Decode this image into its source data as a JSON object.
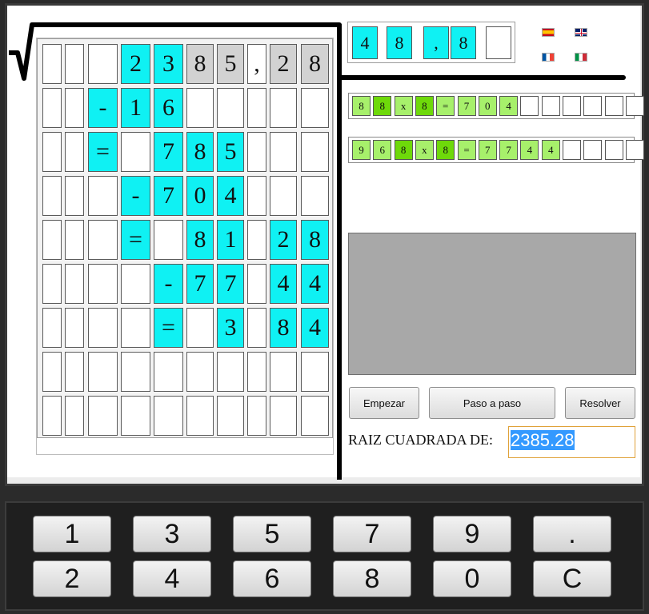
{
  "grid": {
    "rows": [
      [
        {
          "t": "",
          "c": "w"
        },
        {
          "t": "",
          "c": "w"
        },
        {
          "t": "",
          "c": "w"
        },
        {
          "t": "2",
          "c": "cyan"
        },
        {
          "t": "3",
          "c": "cyan"
        },
        {
          "t": "8",
          "c": "gray"
        },
        {
          "t": "5",
          "c": "gray"
        },
        {
          "t": ",",
          "c": "w"
        },
        {
          "t": "2",
          "c": "gray"
        },
        {
          "t": "8",
          "c": "gray"
        }
      ],
      [
        {
          "t": "",
          "c": "w"
        },
        {
          "t": "",
          "c": "w"
        },
        {
          "t": "-",
          "c": "cyan"
        },
        {
          "t": "1",
          "c": "cyan"
        },
        {
          "t": "6",
          "c": "cyan"
        },
        {
          "t": "",
          "c": "w"
        },
        {
          "t": "",
          "c": "w"
        },
        {
          "t": "",
          "c": "w"
        },
        {
          "t": "",
          "c": "w"
        },
        {
          "t": "",
          "c": "w"
        }
      ],
      [
        {
          "t": "",
          "c": "w"
        },
        {
          "t": "",
          "c": "w"
        },
        {
          "t": "=",
          "c": "cyan"
        },
        {
          "t": "",
          "c": "w"
        },
        {
          "t": "7",
          "c": "cyan"
        },
        {
          "t": "8",
          "c": "cyan"
        },
        {
          "t": "5",
          "c": "cyan"
        },
        {
          "t": "",
          "c": "w"
        },
        {
          "t": "",
          "c": "w"
        },
        {
          "t": "",
          "c": "w"
        }
      ],
      [
        {
          "t": "",
          "c": "w"
        },
        {
          "t": "",
          "c": "w"
        },
        {
          "t": "",
          "c": "w"
        },
        {
          "t": "-",
          "c": "cyan"
        },
        {
          "t": "7",
          "c": "cyan"
        },
        {
          "t": "0",
          "c": "cyan"
        },
        {
          "t": "4",
          "c": "cyan"
        },
        {
          "t": "",
          "c": "w"
        },
        {
          "t": "",
          "c": "w"
        },
        {
          "t": "",
          "c": "w"
        }
      ],
      [
        {
          "t": "",
          "c": "w"
        },
        {
          "t": "",
          "c": "w"
        },
        {
          "t": "",
          "c": "w"
        },
        {
          "t": "=",
          "c": "cyan"
        },
        {
          "t": "",
          "c": "w"
        },
        {
          "t": "8",
          "c": "cyan"
        },
        {
          "t": "1",
          "c": "cyan"
        },
        {
          "t": "",
          "c": "w"
        },
        {
          "t": "2",
          "c": "cyan"
        },
        {
          "t": "8",
          "c": "cyan"
        }
      ],
      [
        {
          "t": "",
          "c": "w"
        },
        {
          "t": "",
          "c": "w"
        },
        {
          "t": "",
          "c": "w"
        },
        {
          "t": "",
          "c": "w"
        },
        {
          "t": "-",
          "c": "cyan"
        },
        {
          "t": "7",
          "c": "cyan"
        },
        {
          "t": "7",
          "c": "cyan"
        },
        {
          "t": "",
          "c": "w"
        },
        {
          "t": "4",
          "c": "cyan"
        },
        {
          "t": "4",
          "c": "cyan"
        }
      ],
      [
        {
          "t": "",
          "c": "w"
        },
        {
          "t": "",
          "c": "w"
        },
        {
          "t": "",
          "c": "w"
        },
        {
          "t": "",
          "c": "w"
        },
        {
          "t": "=",
          "c": "cyan"
        },
        {
          "t": "",
          "c": "w"
        },
        {
          "t": "3",
          "c": "cyan"
        },
        {
          "t": "",
          "c": "w"
        },
        {
          "t": "8",
          "c": "cyan"
        },
        {
          "t": "4",
          "c": "cyan"
        }
      ],
      [
        {
          "t": "",
          "c": "w"
        },
        {
          "t": "",
          "c": "w"
        },
        {
          "t": "",
          "c": "w"
        },
        {
          "t": "",
          "c": "w"
        },
        {
          "t": "",
          "c": "w"
        },
        {
          "t": "",
          "c": "w"
        },
        {
          "t": "",
          "c": "w"
        },
        {
          "t": "",
          "c": "w"
        },
        {
          "t": "",
          "c": "w"
        },
        {
          "t": "",
          "c": "w"
        }
      ],
      [
        {
          "t": "",
          "c": "w"
        },
        {
          "t": "",
          "c": "w"
        },
        {
          "t": "",
          "c": "w"
        },
        {
          "t": "",
          "c": "w"
        },
        {
          "t": "",
          "c": "w"
        },
        {
          "t": "",
          "c": "w"
        },
        {
          "t": "",
          "c": "w"
        },
        {
          "t": "",
          "c": "w"
        },
        {
          "t": "",
          "c": "w"
        },
        {
          "t": "",
          "c": "w"
        }
      ]
    ]
  },
  "result": [
    {
      "t": "4",
      "c": "cyan"
    },
    {
      "t": "8",
      "c": "cyan"
    },
    {
      "t": ",",
      "c": "cyan"
    },
    {
      "t": "8",
      "c": "cyan"
    },
    {
      "t": "",
      "c": "w"
    }
  ],
  "languages": [
    {
      "name": "spain-flag-icon",
      "flag": "es"
    },
    {
      "name": "uk-flag-icon",
      "flag": "uk"
    },
    {
      "name": "france-flag-icon",
      "flag": "fr"
    },
    {
      "name": "italy-flag-icon",
      "flag": "it"
    }
  ],
  "equations": [
    [
      {
        "t": "8",
        "c": "lg"
      },
      {
        "t": "8",
        "c": "dg"
      },
      {
        "t": "x",
        "c": "lg"
      },
      {
        "t": "8",
        "c": "dg"
      },
      {
        "t": "=",
        "c": "lg"
      },
      {
        "t": "7",
        "c": "lg"
      },
      {
        "t": "0",
        "c": "lg"
      },
      {
        "t": "4",
        "c": "lg"
      },
      {
        "t": "",
        "c": "w"
      },
      {
        "t": "",
        "c": "w"
      },
      {
        "t": "",
        "c": "w"
      },
      {
        "t": "",
        "c": "w"
      },
      {
        "t": "",
        "c": "w"
      },
      {
        "t": "",
        "c": "w"
      }
    ],
    [
      {
        "t": "9",
        "c": "lg"
      },
      {
        "t": "6",
        "c": "lg"
      },
      {
        "t": "8",
        "c": "dg"
      },
      {
        "t": "x",
        "c": "lg"
      },
      {
        "t": "8",
        "c": "dg"
      },
      {
        "t": "=",
        "c": "lg"
      },
      {
        "t": "7",
        "c": "lg"
      },
      {
        "t": "7",
        "c": "lg"
      },
      {
        "t": "4",
        "c": "lg"
      },
      {
        "t": "4",
        "c": "lg"
      },
      {
        "t": "",
        "c": "w"
      },
      {
        "t": "",
        "c": "w"
      },
      {
        "t": "",
        "c": "w"
      },
      {
        "t": "",
        "c": "w"
      }
    ]
  ],
  "buttons": {
    "start": "Empezar",
    "step": "Paso a paso",
    "solve": "Resolver"
  },
  "input": {
    "label": "RAIZ CUADRADA DE:",
    "value": "2385.28"
  },
  "keypad": {
    "row1": [
      "1",
      "3",
      "5",
      "7",
      "9",
      "."
    ],
    "row2": [
      "2",
      "4",
      "6",
      "8",
      "0",
      "C"
    ]
  },
  "colors": {
    "cyan": "#0ff1f3",
    "gray_cell": "#d2d2d2",
    "light_green": "#a7f06b",
    "dark_green": "#6ed90a",
    "selection": "#3399ff"
  }
}
